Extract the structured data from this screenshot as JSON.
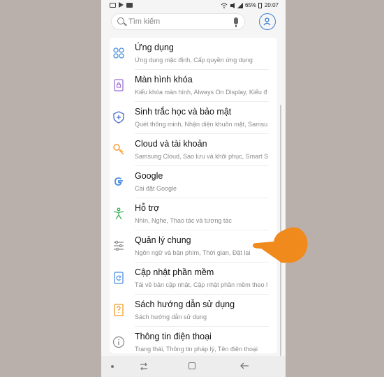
{
  "status_bar": {
    "battery": "65%",
    "time": "20:07",
    "icons_left": [
      "image-icon",
      "play-icon",
      "youtube-icon"
    ],
    "icons_right": [
      "wifi-icon",
      "silent-icon",
      "signal-icon",
      "battery-icon"
    ]
  },
  "search": {
    "placeholder": "Tìm kiếm",
    "icon": "search-icon",
    "mic_icon": "mic-icon",
    "account_icon": "account-icon",
    "accent_color": "#3c7ed6"
  },
  "settings": [
    {
      "title": "Ứng dụng",
      "subtitle": "Ứng dụng mặc định, Cấp quyền ứng dụng",
      "icon": "apps-icon"
    },
    {
      "title": "Màn hình khóa",
      "subtitle": "Kiểu khóa màn hình, Always On Display, Kiểu đ",
      "icon": "lock-screen-icon"
    },
    {
      "title": "Sinh trắc học và bảo mật",
      "subtitle": "Quét thông minh, Nhận diện khuôn mặt, Samsu",
      "icon": "shield-icon"
    },
    {
      "title": "Cloud và tài khoản",
      "subtitle": "Samsung Cloud, Sao lưu và khôi phục, Smart S",
      "icon": "key-icon"
    },
    {
      "title": "Google",
      "subtitle": "Cài đặt Google",
      "icon": "google-icon"
    },
    {
      "title": "Hỗ trợ",
      "subtitle": "Nhìn, Nghe, Thao tác và tương tác",
      "icon": "accessibility-icon"
    },
    {
      "title": "Quản lý chung",
      "subtitle": "Ngôn ngữ và bàn phím, Thời gian, Đặt lại",
      "icon": "sliders-icon"
    },
    {
      "title": "Cập nhật phần mềm",
      "subtitle": "Tải về bản cập nhật, Cập nhật phần mềm theo l",
      "icon": "software-update-icon"
    },
    {
      "title": "Sách hướng dẫn sử dụng",
      "subtitle": "Sách hướng dẫn sử dụng",
      "icon": "manual-icon"
    },
    {
      "title": "Thông tin điện thoại",
      "subtitle": "Trạng thái, Thông tin pháp lý, Tên điện thoại",
      "icon": "info-icon"
    }
  ],
  "navigation": [
    "dot-icon",
    "recent-apps-icon",
    "home-icon",
    "back-icon"
  ],
  "colors": {
    "background": "#b9b0ac",
    "pointer": "#f08a1c",
    "icon_blue": "#4a8fe0",
    "icon_orange": "#f39a2b",
    "icon_green": "#3cae57"
  }
}
